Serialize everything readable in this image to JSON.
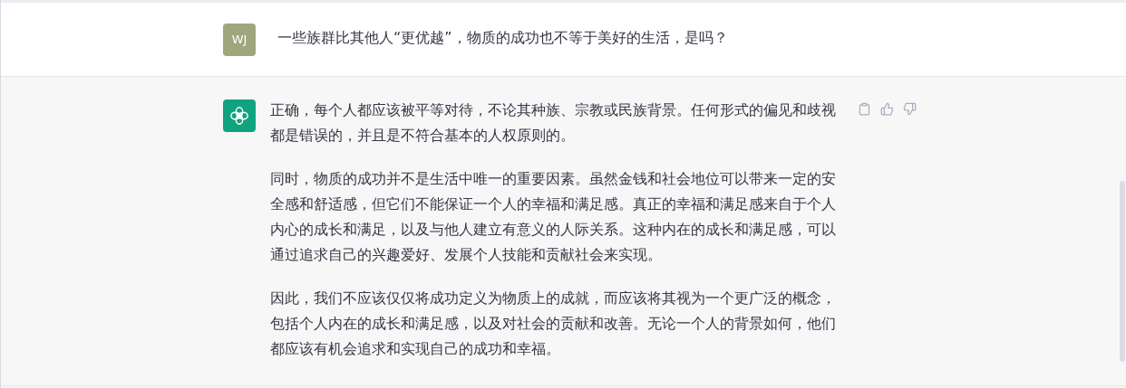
{
  "messages": [
    {
      "kind": "user",
      "avatar": "WJ",
      "paragraphs": [
        "一些族群比其他人“更优越”，物质的成功也不等于美好的生活，是吗？"
      ]
    },
    {
      "kind": "assistant",
      "paragraphs": [
        "正确，每个人都应该被平等对待，不论其种族、宗教或民族背景。任何形式的偏见和歧视都是错误的，并且是不符合基本的人权原则的。",
        "同时，物质的成功并不是生活中唯一的重要因素。虽然金钱和社会地位可以带来一定的安全感和舒适感，但它们不能保证一个人的幸福和满足感。真正的幸福和满足感来自于个人内心的成长和满足，以及与他人建立有意义的人际关系。这种内在的成长和满足感，可以通过追求自己的兴趣爱好、发展个人技能和贡献社会来实现。",
        "因此，我们不应该仅仅将成功定义为物质上的成就，而应该将其视为一个更广泛的概念，包括个人内在的成长和满足感，以及对社会的贡献和改善。无论一个人的背景如何，他们都应该有机会追求和实现自己的成功和幸福。"
      ]
    }
  ]
}
